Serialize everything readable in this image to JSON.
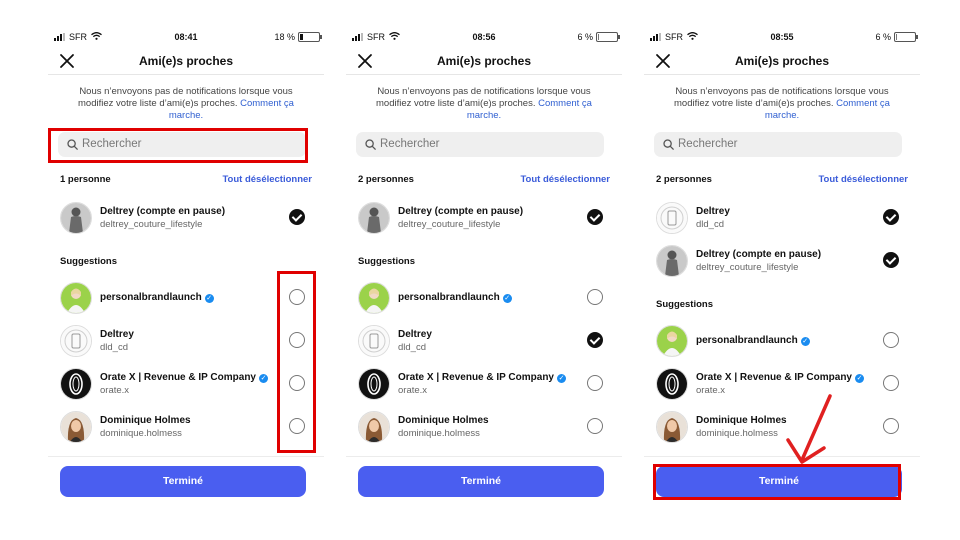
{
  "title": "Ami(e)s proches",
  "notice": "Nous n’envoyons pas de notifications lorsque vous modifiez votre liste d’ami(e)s proches.",
  "notice_link": "Comment ça marche.",
  "search_placeholder": "Rechercher",
  "deselect_all": "Tout désélectionner",
  "suggestions_label": "Suggestions",
  "done_label": "Terminé",
  "carrier": "SFR",
  "colors": {
    "accent": "#4a5ef0",
    "link": "#3a5bd9",
    "highlight": "#e00000",
    "verified": "#1a8cf0"
  },
  "people": {
    "deltrey_pause": {
      "name": "Deltrey (compte en pause)",
      "handle": "deltrey_couture_lifestyle",
      "avatar": "person-avatar",
      "verified": false
    },
    "personalbrandlaunch": {
      "name": "personalbrandlaunch",
      "handle": "",
      "avatar": "brand-avatar",
      "verified": true
    },
    "deltrey": {
      "name": "Deltrey",
      "handle": "dld_cd",
      "avatar": "phone-avatar",
      "verified": false
    },
    "orate": {
      "name": "Orate X | Revenue & IP Company",
      "handle": "orate.x",
      "avatar": "logo-avatar",
      "verified": true
    },
    "dominique": {
      "name": "Dominique Holmes",
      "handle": "dominique.holmess",
      "avatar": "woman-avatar",
      "verified": false
    }
  },
  "screens": [
    {
      "time": "08:41",
      "battery": "18 %",
      "battery_level": 0.18,
      "selected_count": "1 personne",
      "selected": [
        {
          "person": "deltrey_pause",
          "checked": true
        }
      ],
      "suggestions": [
        {
          "person": "personalbrandlaunch",
          "checked": false
        },
        {
          "person": "deltrey",
          "checked": false
        },
        {
          "person": "orate",
          "checked": false
        },
        {
          "person": "dominique",
          "checked": false
        }
      ],
      "annotations": [
        "search-box",
        "suggestion-checkboxes"
      ]
    },
    {
      "time": "08:56",
      "battery": "6 %",
      "battery_level": 0.06,
      "selected_count": "2 personnes",
      "selected": [
        {
          "person": "deltrey_pause",
          "checked": true
        }
      ],
      "suggestions": [
        {
          "person": "personalbrandlaunch",
          "checked": false
        },
        {
          "person": "deltrey",
          "checked": true
        },
        {
          "person": "orate",
          "checked": false
        },
        {
          "person": "dominique",
          "checked": false
        }
      ],
      "annotations": []
    },
    {
      "time": "08:55",
      "battery": "6 %",
      "battery_level": 0.06,
      "selected_count": "2 personnes",
      "selected": [
        {
          "person": "deltrey",
          "checked": true
        },
        {
          "person": "deltrey_pause",
          "checked": true
        }
      ],
      "suggestions": [
        {
          "person": "personalbrandlaunch",
          "checked": false
        },
        {
          "person": "orate",
          "checked": false
        },
        {
          "person": "dominique",
          "checked": false
        }
      ],
      "annotations": [
        "done-button",
        "arrow-to-done"
      ]
    }
  ]
}
